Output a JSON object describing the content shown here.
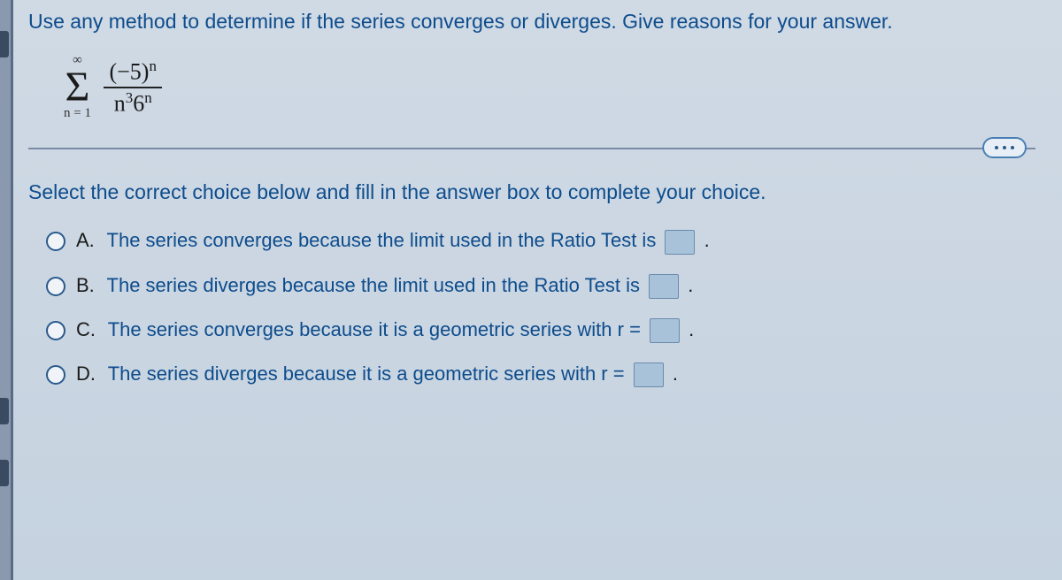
{
  "question": "Use any method to determine if the series converges or diverges. Give reasons for your answer.",
  "series": {
    "upper": "∞",
    "lower": "n = 1",
    "numerator_base": "(−5)",
    "numerator_exp": "n",
    "denom_n": "n",
    "denom_n_exp": "3",
    "denom_base": "6",
    "denom_base_exp": "n"
  },
  "instruction": "Select the correct choice below and fill in the answer box to complete your choice.",
  "choices": {
    "a": {
      "letter": "A.",
      "text": "The series converges because the limit used in the Ratio Test is "
    },
    "b": {
      "letter": "B.",
      "text": "The series diverges because the limit used in the Ratio Test is "
    },
    "c": {
      "letter": "C.",
      "text": "The series converges because it is a geometric series with r = "
    },
    "d": {
      "letter": "D.",
      "text": "The series diverges because it is a geometric series with r = "
    }
  },
  "period": "."
}
